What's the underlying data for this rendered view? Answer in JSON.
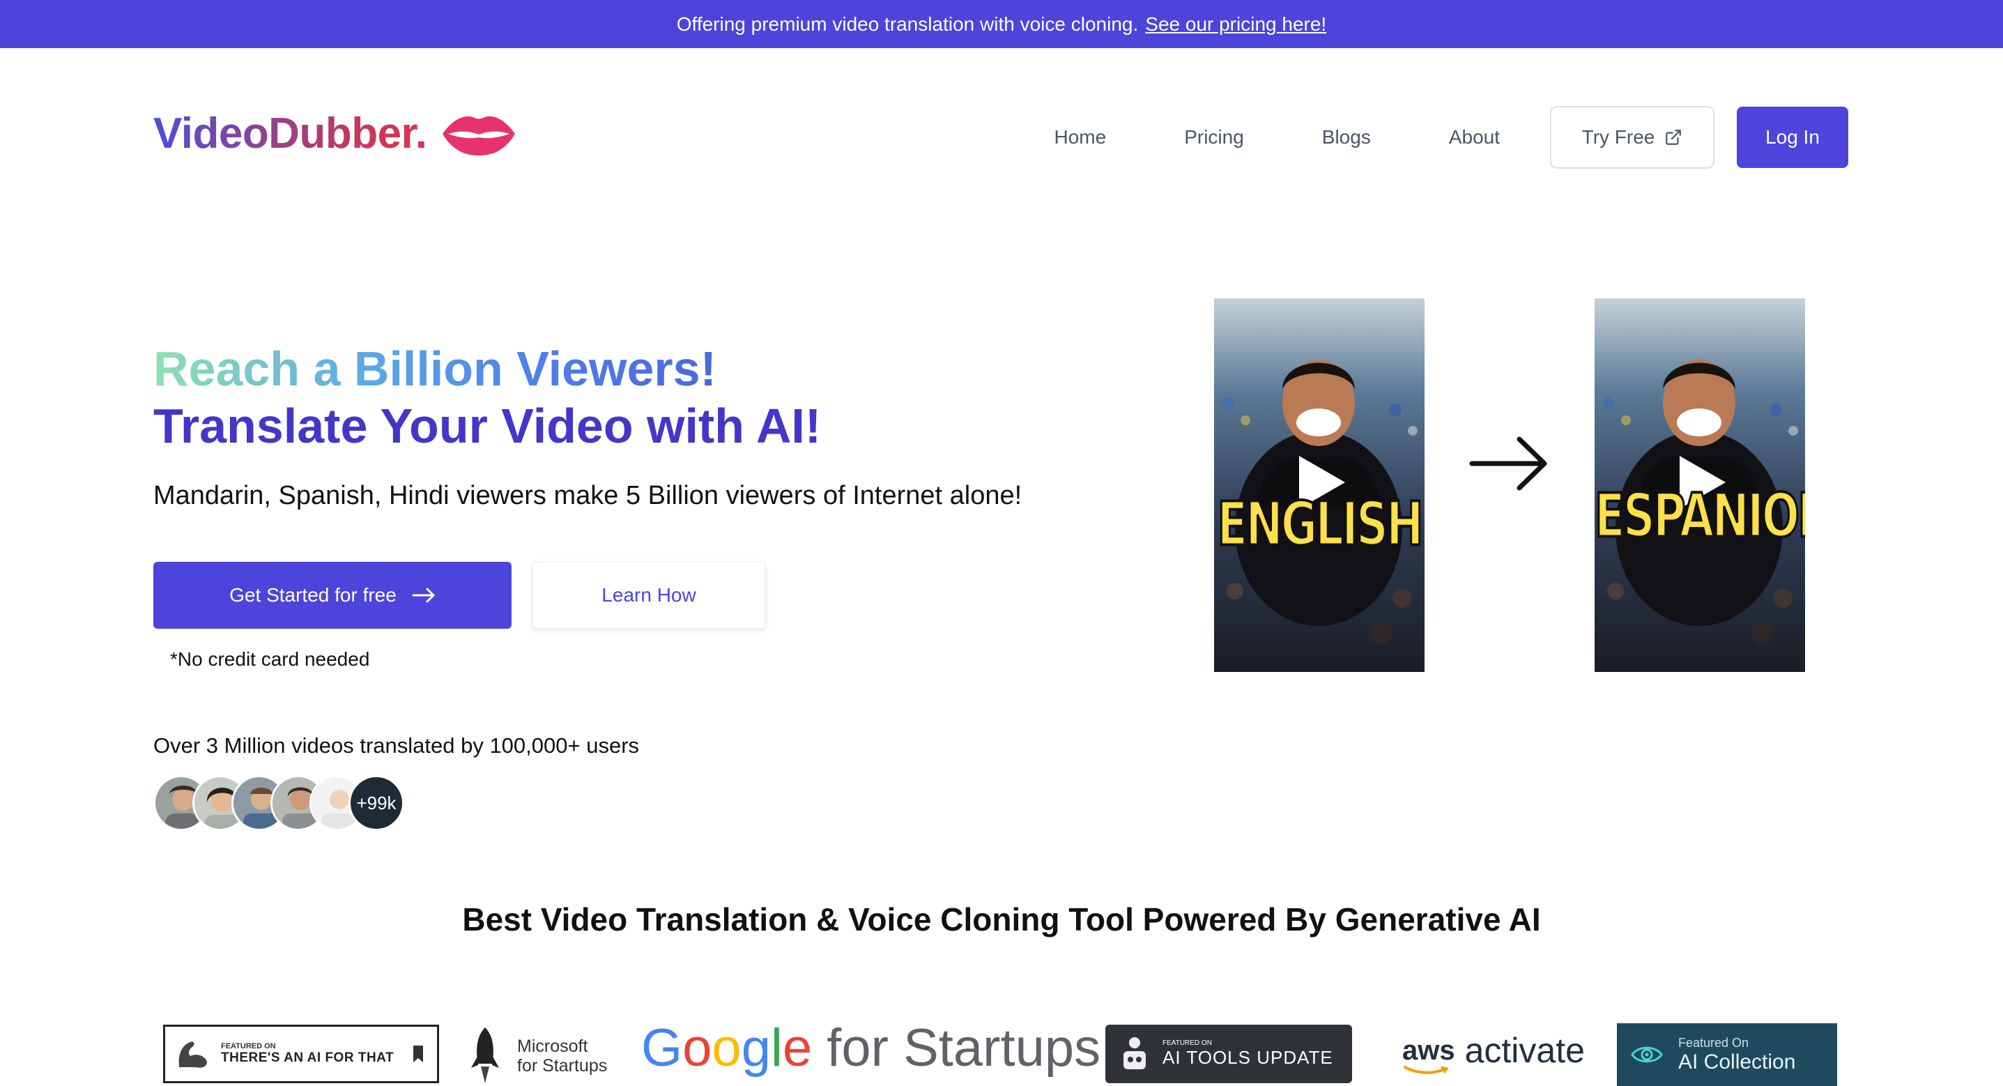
{
  "banner": {
    "text": "Offering premium video translation with voice cloning.",
    "link": "See our pricing here!"
  },
  "brand": {
    "name": "VideoDubber.",
    "logo_icon": "lips-icon"
  },
  "nav": {
    "items": [
      "Home",
      "Pricing",
      "Blogs",
      "About"
    ],
    "try_free": "Try Free",
    "login": "Log In"
  },
  "hero": {
    "headline_1": "Reach a Billion Viewers!",
    "headline_2": "Translate Your Video with AI!",
    "subheadline": "Mandarin, Spanish, Hindi viewers make 5 Billion viewers of Internet alone!",
    "cta_primary": "Get Started for free",
    "cta_secondary": "Learn How",
    "note": "*No credit card needed",
    "stats": "Over 3 Million videos translated by 100,000+ users",
    "avatar_count": "+99k"
  },
  "videos": [
    {
      "label": "ENGLISH"
    },
    {
      "label": "ESPANIOL"
    }
  ],
  "section": {
    "title": "Best Video Translation & Voice Cloning Tool Powered By Generative AI"
  },
  "featured": {
    "aiforthat_small": "FEATURED ON",
    "aiforthat_big": "THERE'S AN AI FOR THAT",
    "microsoft_line1": "Microsoft",
    "microsoft_line2": "for Startups",
    "google_word": "Google",
    "google_suffix": "for Startups",
    "aitools_small": "FEATURED ON",
    "aitools_big": "AI TOOLS UPDATE",
    "aws_word": "aws",
    "aws_suffix": "activate",
    "aicollection_small": "Featured On",
    "aicollection_big": "AI Collection"
  },
  "colors": {
    "accent": "#4d44dc",
    "headline_dark": "#4336c9",
    "lips": "#e8326f"
  }
}
